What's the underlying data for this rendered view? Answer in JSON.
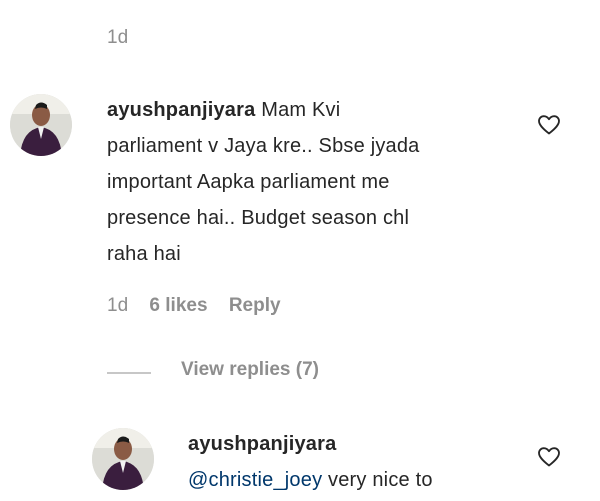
{
  "top_comment": {
    "time": "1d"
  },
  "comment": {
    "username": "ayushpanjiyara",
    "lines": [
      "Mam Kvi",
      "parliament v Jaya kre.. Sbse jyada",
      "important Aapka parliament me",
      "presence hai.. Budget season chl",
      "raha hai"
    ],
    "time": "1d",
    "likes": "6 likes",
    "reply_label": "Reply",
    "view_replies": "View replies (7)"
  },
  "reply": {
    "username": "ayushpanjiyara",
    "mention": "@christie_joey",
    "text": " very nice to"
  },
  "icons": {
    "like": "heart-outline-icon",
    "avatar": "user-avatar"
  },
  "colors": {
    "text": "#262626",
    "secondary": "#8e8e8e",
    "mention": "#00376b"
  }
}
